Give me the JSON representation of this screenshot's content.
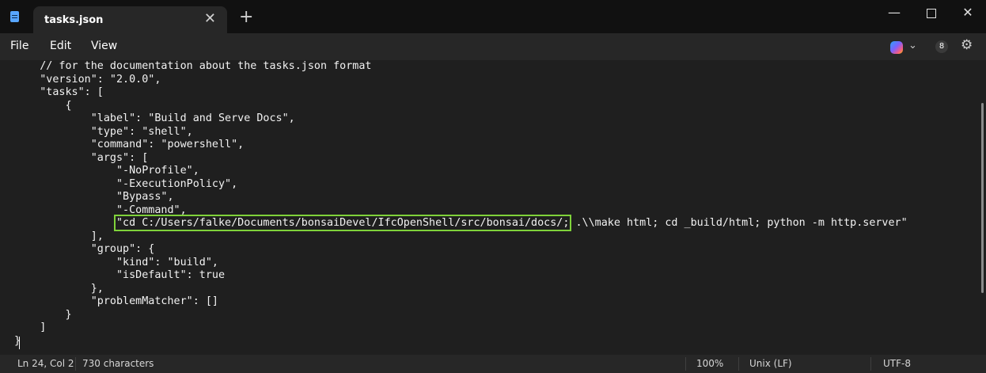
{
  "window": {
    "tab_title": "tasks.json",
    "tab_close": "✕",
    "new_tab": "+",
    "minimize": "—",
    "close": "✕"
  },
  "menu": {
    "file": "File",
    "edit": "Edit",
    "view": "View"
  },
  "toolbar": {
    "chevron": "⌄",
    "account_initial": "8",
    "settings": "⚙"
  },
  "editor": {
    "lines": [
      "    // for the documentation about the tasks.json format",
      "    \"version\": \"2.0.0\",",
      "    \"tasks\": [",
      "        {",
      "            \"label\": \"Build and Serve Docs\",",
      "            \"type\": \"shell\",",
      "            \"command\": \"powershell\",",
      "            \"args\": [",
      "                \"-NoProfile\",",
      "                \"-ExecutionPolicy\",",
      "                \"Bypass\",",
      "                \"-Command\",",
      "                ",
      "            ],",
      "            \"group\": {",
      "                \"kind\": \"build\",",
      "                \"isDefault\": true",
      "            },",
      "            \"problemMatcher\": []",
      "        }",
      "    ]",
      "}"
    ],
    "highlighted_segment": "\"cd C:/Users/falke/Documents/bonsaiDevel/IfcOpenShell/src/bonsai/docs/;",
    "highlighted_rest": " .\\\\make html; cd _build/html; python -m http.server\""
  },
  "status": {
    "position": "Ln 24, Col 2",
    "characters": "730 characters",
    "zoom": "100%",
    "line_ending": "Unix (LF)",
    "encoding": "UTF-8"
  }
}
